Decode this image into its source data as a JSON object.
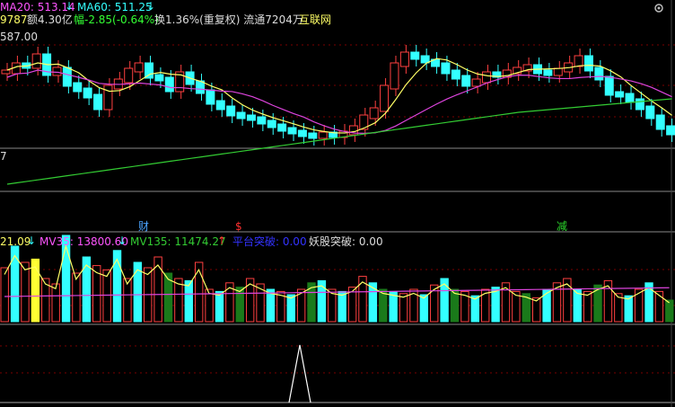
{
  "top_info": {
    "ma20": "MA20: 513.14",
    "ma60": "MA60: 511.25",
    "amount_prefix": "9787",
    "amount": "额4.30亿",
    "change": "幅-2.85(-0.64%)",
    "turnover": "换1.36%(重复权) 流通7204万",
    "exchange": "互联网",
    "price_high": "587.00",
    "left_edge_mark": "7"
  },
  "markers": [
    {
      "label": "财",
      "color": "#4aa3ff"
    },
    {
      "label": "$",
      "color": "#ff3030"
    },
    {
      "label": "减",
      "color": "#2bd52b"
    }
  ],
  "volume_info": {
    "v1": "21.09",
    "mv35": "MV35: 13800.60",
    "mv135": "MV135: 11474.27",
    "platform": "平台突破: 0.00",
    "demon": "妖股突破: 0.00"
  },
  "colors": {
    "up": "#ff4040",
    "down": "#33ffff",
    "ma_yellow": "#ffff66",
    "ma_magenta": "#dd44dd",
    "ma_green": "#33cc33",
    "vol_green": "#1a7a1a",
    "grid": "#7a0000"
  },
  "icons": {
    "settings": "gear-icon"
  }
}
